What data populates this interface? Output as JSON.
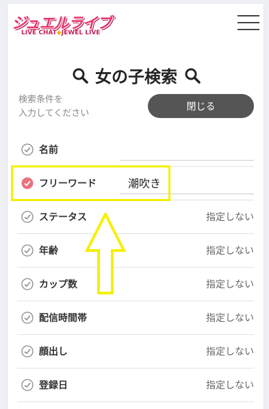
{
  "header": {
    "logo_main": "ジュエルライブ",
    "logo_sub_left": "LIVE CHAT",
    "logo_sub_right": "JEWEL LIVE"
  },
  "search": {
    "title": "女の子検索",
    "hint": "検索条件を\n入力してください",
    "close_label": "閉じる"
  },
  "fields": [
    {
      "label": "名前",
      "type": "text",
      "value": ""
    },
    {
      "label": "フリーワード",
      "type": "text",
      "value": "潮吹き",
      "checked": true
    },
    {
      "label": "ステータス",
      "value": "指定しない"
    },
    {
      "label": "年齢",
      "value": "指定しない"
    },
    {
      "label": "カップ数",
      "value": "指定しない"
    },
    {
      "label": "配信時間帯",
      "value": "指定しない"
    },
    {
      "label": "顔出し",
      "value": "指定しない"
    },
    {
      "label": "登録日",
      "value": "指定しない"
    }
  ],
  "colors": {
    "accent_pink": "#e8356d",
    "check_active": "#e8727f",
    "close_button": "#555555",
    "annotation_yellow": "#f5f000"
  }
}
